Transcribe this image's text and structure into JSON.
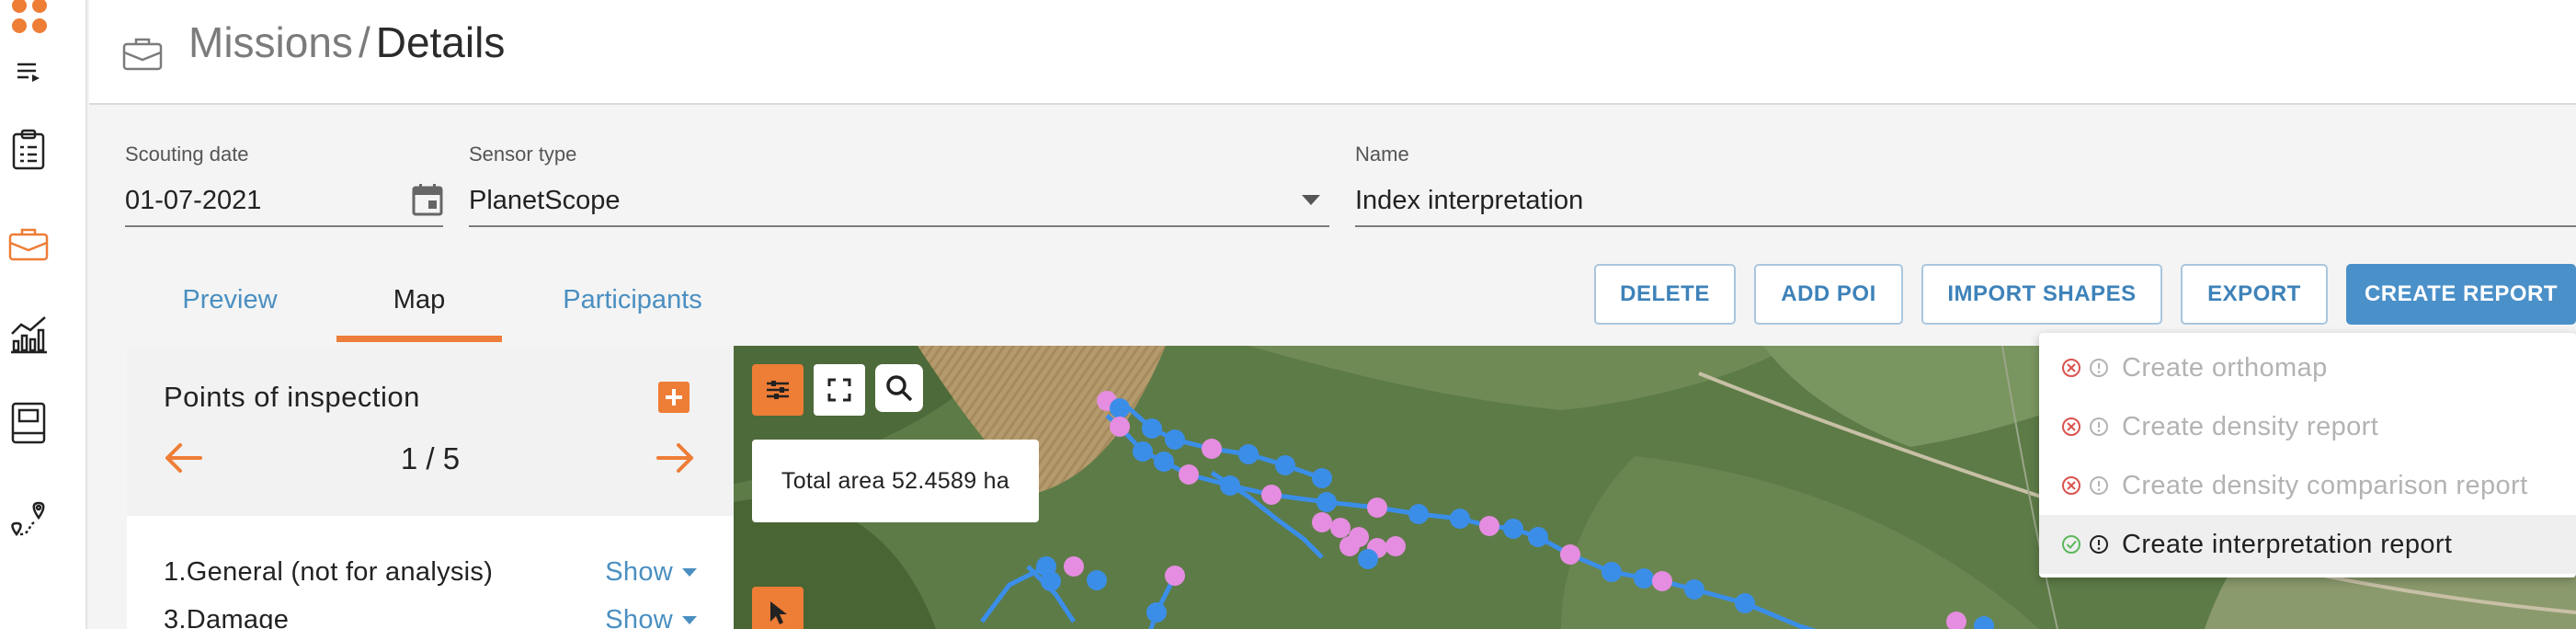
{
  "colors": {
    "accent": "#ee7d36",
    "link": "#4a8fc1",
    "primary_button": "#4a90c9",
    "track_blue": "#3b8ee8",
    "track_pink": "#e58de0",
    "error": "#d9534f",
    "success": "#5cb85c"
  },
  "sidebar": {
    "items": [
      {
        "name": "apps-grid-icon"
      },
      {
        "name": "menu-list-icon"
      },
      {
        "name": "clipboard-icon"
      },
      {
        "name": "briefcase-icon",
        "active": true
      },
      {
        "name": "chart-icon"
      },
      {
        "name": "book-icon"
      },
      {
        "name": "route-pins-icon"
      }
    ]
  },
  "header": {
    "icon": "briefcase-icon",
    "breadcrumb": "Missions",
    "separator": "/",
    "current": "Details"
  },
  "form": {
    "scouting_date": {
      "label": "Scouting date",
      "value": "01-07-2021",
      "icon": "calendar-icon"
    },
    "sensor_type": {
      "label": "Sensor type",
      "value": "PlanetScope",
      "icon": "dropdown-caret-icon"
    },
    "name": {
      "label": "Name",
      "value": "Index interpretation"
    }
  },
  "tabs": [
    {
      "label": "Preview",
      "active": false
    },
    {
      "label": "Map",
      "active": true
    },
    {
      "label": "Participants",
      "active": false
    }
  ],
  "actions": {
    "delete": "DELETE",
    "add_poi": "ADD POI",
    "import_shapes": "IMPORT SHAPES",
    "export": "EXPORT",
    "create_report": "CREATE REPORT"
  },
  "poi_panel": {
    "title": "Points of inspection",
    "pager": "1 / 5",
    "rows": [
      {
        "label": "1.General (not for analysis)",
        "action": "Show"
      },
      {
        "label": "3.Damage",
        "action": "Show"
      }
    ]
  },
  "map": {
    "total_area": "Total area 52.4589 ha",
    "tools": [
      "layers-settings-icon",
      "fullscreen-icon",
      "search-icon",
      "cursor-icon"
    ]
  },
  "report_menu": {
    "items": [
      {
        "label": "Create orthomap",
        "enabled": false,
        "status_icon": "error-circle-icon"
      },
      {
        "label": "Create density report",
        "enabled": false,
        "status_icon": "error-circle-icon"
      },
      {
        "label": "Create density comparison report",
        "enabled": false,
        "status_icon": "error-circle-icon"
      },
      {
        "label": "Create interpretation report",
        "enabled": true,
        "status_icon": "check-circle-icon"
      }
    ]
  }
}
